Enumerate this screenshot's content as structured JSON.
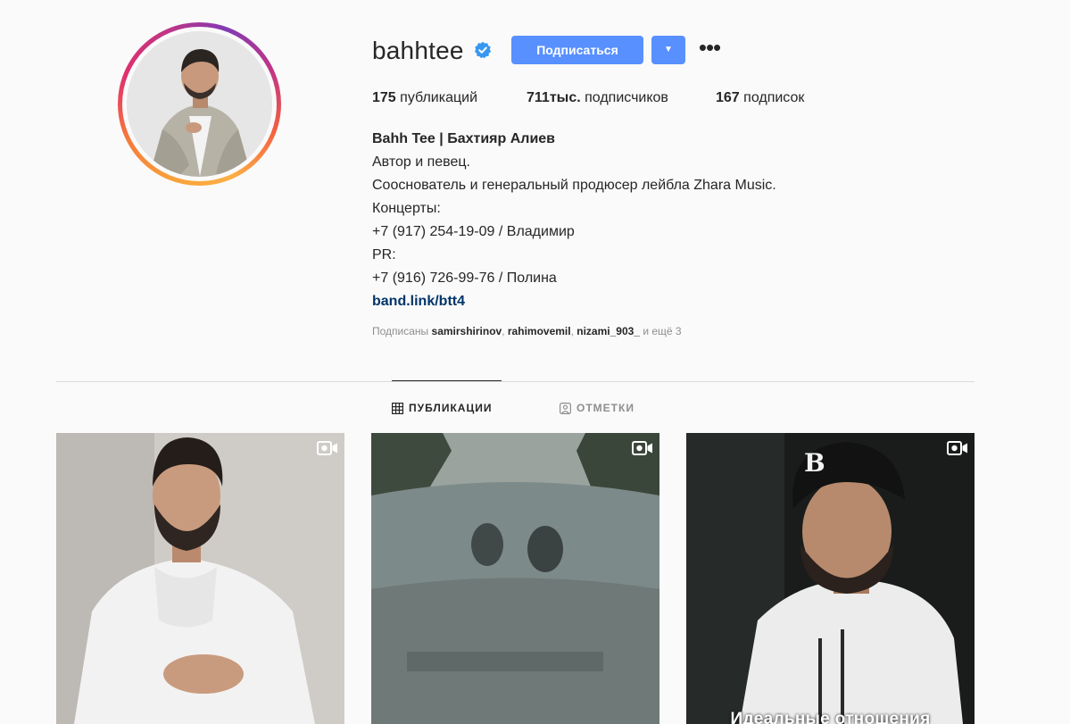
{
  "profile": {
    "username": "bahhtee",
    "follow_label": "Подписаться",
    "dropdown_glyph": "▼",
    "more_glyph": "•••",
    "stats": {
      "posts_count": "175",
      "posts_label": "публикаций",
      "followers_count": "711тыс.",
      "followers_label": "подписчиков",
      "following_count": "167",
      "following_label": "подписок"
    },
    "bio": {
      "name": "Bahh Tee | Бахтияр Алиев",
      "lines": [
        "Автор и певец.",
        "Сооснователь и генеральный продюсер лейбла Zhara Music.",
        "Концерты:",
        "+7 (917) 254-19-09 / Владимир",
        "PR:",
        "+7 (916) 726-99-76 / Полина"
      ],
      "link": "band.link/btt4"
    },
    "followed_by": {
      "prefix": "Подписаны",
      "users": [
        "samirshirinov",
        "rahimovemil",
        "nizami_903_"
      ],
      "suffix": "и ещё 3"
    }
  },
  "tabs": [
    {
      "label": "ПУБЛИКАЦИИ",
      "icon": "grid-icon",
      "active": true
    },
    {
      "label": "ОТМЕТКИ",
      "icon": "tag-person-icon",
      "active": false
    }
  ],
  "posts": [
    {
      "type": "video",
      "icon": "video-icon",
      "caption": ""
    },
    {
      "type": "video",
      "icon": "video-icon",
      "caption": ""
    },
    {
      "type": "video",
      "icon": "video-icon",
      "caption": "Идеальные отношения"
    }
  ],
  "colors": {
    "primary_button": "#5890ff",
    "link": "#003569",
    "muted_text": "#8e8e8e",
    "background": "#fafafa"
  }
}
